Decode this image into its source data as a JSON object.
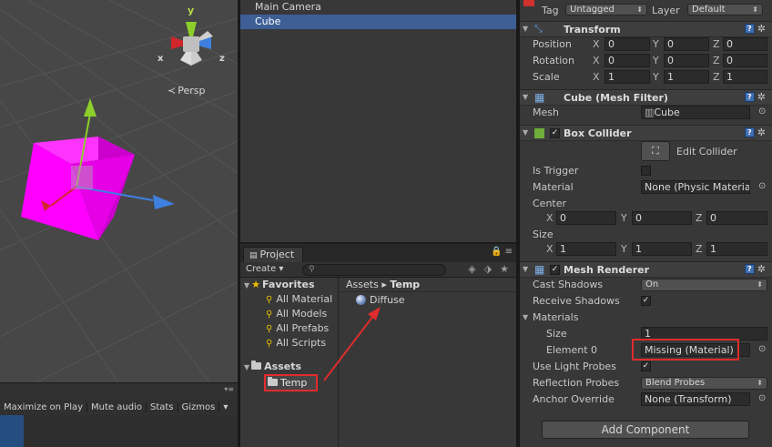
{
  "scene": {
    "projection_label": "Persp",
    "gizmo_axes": {
      "x": "x",
      "y": "y",
      "z": "z"
    },
    "colors": {
      "background": "#474747",
      "cube": "#ff00ff",
      "x_axis": "#d0262c",
      "y_axis": "#8ccf2a",
      "z_axis": "#3f7fe0"
    }
  },
  "game_toolbar": {
    "items": [
      "Maximize on Play",
      "Mute audio",
      "Stats",
      "Gizmos"
    ],
    "gizmos_caret": "▾"
  },
  "hierarchy": {
    "items": [
      {
        "label": "Main Camera",
        "selected": false
      },
      {
        "label": "Cube",
        "selected": true
      }
    ]
  },
  "project": {
    "tab_label": "Project",
    "create_label": "Create",
    "favorites_label": "Favorites",
    "favorites": [
      "All Material",
      "All Models",
      "All Prefabs",
      "All Scripts"
    ],
    "assets_label": "Assets",
    "selected_folder": "Temp",
    "breadcrumb": {
      "root": "Assets",
      "separator": "▸",
      "current": "Temp"
    },
    "files": [
      "Diffuse"
    ]
  },
  "inspector": {
    "tag_label": "Tag",
    "tag_value": "Untagged",
    "layer_label": "Layer",
    "layer_value": "Default",
    "transform": {
      "title": "Transform",
      "position": {
        "label": "Position",
        "x": "0",
        "y": "0",
        "z": "0"
      },
      "rotation": {
        "label": "Rotation",
        "x": "0",
        "y": "0",
        "z": "0"
      },
      "scale": {
        "label": "Scale",
        "x": "1",
        "y": "1",
        "z": "1"
      }
    },
    "mesh_filter": {
      "title": "Cube (Mesh Filter)",
      "mesh_label": "Mesh",
      "mesh_value": "Cube"
    },
    "box_collider": {
      "title": "Box Collider",
      "edit_label": "Edit Collider",
      "is_trigger_label": "Is Trigger",
      "is_trigger": false,
      "material_label": "Material",
      "material_value": "None (Physic Materia",
      "center_label": "Center",
      "center": {
        "x": "0",
        "y": "0",
        "z": "0"
      },
      "size_label": "Size",
      "size": {
        "x": "1",
        "y": "1",
        "z": "1"
      }
    },
    "mesh_renderer": {
      "title": "Mesh Renderer",
      "cast_shadows_label": "Cast Shadows",
      "cast_shadows_value": "On",
      "receive_shadows_label": "Receive Shadows",
      "receive_shadows": true,
      "materials_label": "Materials",
      "size_label": "Size",
      "size_value": "1",
      "element0_label": "Element 0",
      "element0_value": "Missing (Material)",
      "light_probes_label": "Use Light Probes",
      "light_probes": true,
      "reflection_probes_label": "Reflection Probes",
      "reflection_probes_value": "Blend Probes",
      "anchor_override_label": "Anchor Override",
      "anchor_override_value": "None (Transform)"
    },
    "add_component_label": "Add Component",
    "axis_labels": {
      "x": "X",
      "y": "Y",
      "z": "Z"
    }
  },
  "annotation_color": "#e02c2c"
}
